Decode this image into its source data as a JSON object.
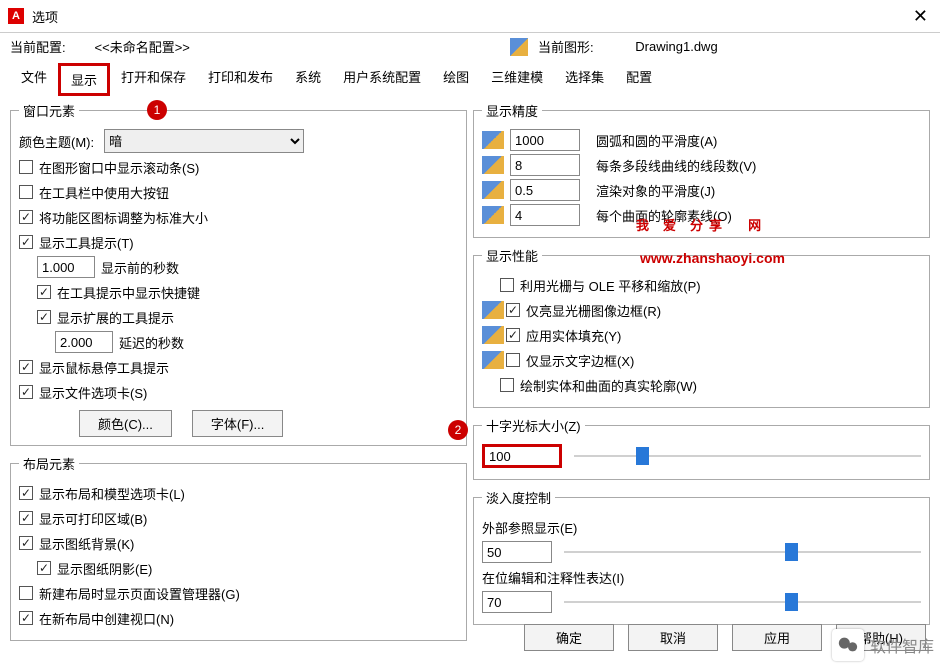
{
  "window": {
    "title": "选项",
    "close": "✕",
    "app_icon_letter": "A"
  },
  "header": {
    "profile_label": "当前配置:",
    "profile_value": "<<未命名配置>>",
    "drawing_label": "当前图形:",
    "drawing_value": "Drawing1.dwg"
  },
  "tabs": [
    "文件",
    "显示",
    "打开和保存",
    "打印和发布",
    "系统",
    "用户系统配置",
    "绘图",
    "三维建模",
    "选择集",
    "配置"
  ],
  "window_elements": {
    "legend": "窗口元素",
    "theme_label": "颜色主题(M):",
    "theme_value": "暗",
    "scrollbars": "在图形窗口中显示滚动条(S)",
    "big_buttons": "在工具栏中使用大按钮",
    "resize_ribbon": "将功能区图标调整为标准大小",
    "show_tooltip": "显示工具提示(T)",
    "seconds_before": "显示前的秒数",
    "seconds_before_val": "1.000",
    "shortcut_in_tooltip": "在工具提示中显示快捷键",
    "ext_tooltip": "显示扩展的工具提示",
    "delay_sec": "延迟的秒数",
    "delay_sec_val": "2.000",
    "hover_tooltip": "显示鼠标悬停工具提示",
    "file_tabs": "显示文件选项卡(S)",
    "color_btn": "颜色(C)...",
    "font_btn": "字体(F)..."
  },
  "layout_elements": {
    "legend": "布局元素",
    "tabs": "显示布局和模型选项卡(L)",
    "print_area": "显示可打印区域(B)",
    "paper_bg": "显示图纸背景(K)",
    "paper_shadow": "显示图纸阴影(E)",
    "page_setup_mgr": "新建布局时显示页面设置管理器(G)",
    "create_viewport": "在新布局中创建视口(N)"
  },
  "display_resolution": {
    "legend": "显示精度",
    "items": [
      {
        "val": "1000",
        "label": "圆弧和圆的平滑度(A)"
      },
      {
        "val": "8",
        "label": "每条多段线曲线的线段数(V)"
      },
      {
        "val": "0.5",
        "label": "渲染对象的平滑度(J)"
      },
      {
        "val": "4",
        "label": "每个曲面的轮廓素线(O)"
      }
    ]
  },
  "display_performance": {
    "legend": "显示性能",
    "pan_zoom": "利用光栅与 OLE 平移和缩放(P)",
    "highlight_frame": "仅亮显光栅图像边框(R)",
    "solid_fill": "应用实体填充(Y)",
    "text_frame": "仅显示文字边框(X)",
    "true_silhouette": "绘制实体和曲面的真实轮廓(W)"
  },
  "crosshair": {
    "legend": "十字光标大小(Z)",
    "value": "100",
    "pct": 18
  },
  "fade": {
    "legend": "淡入度控制",
    "xref_label": "外部参照显示(E)",
    "xref_val": "50",
    "xref_pct": 62,
    "inplace_label": "在位编辑和注释性表达(I)",
    "inplace_val": "70",
    "inplace_pct": 62
  },
  "footer": {
    "ok": "确定",
    "cancel": "取消",
    "apply": "应用",
    "help": "帮助(H)"
  },
  "watermark": {
    "line1_a": "我爱",
    "line1_b": "分享",
    "line1_c": "网",
    "line2": "www.zhanshaoyi.com",
    "corner": "软件智库"
  }
}
